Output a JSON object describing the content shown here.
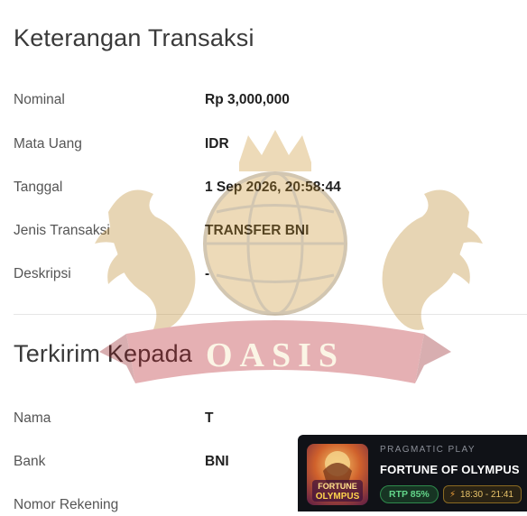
{
  "transaction": {
    "title": "Keterangan Transaksi",
    "rows": [
      {
        "label": "Nominal",
        "value": "Rp 3,000,000"
      },
      {
        "label": "Mata Uang",
        "value": "IDR"
      },
      {
        "label": "Tanggal",
        "value": "1 Sep 2026, 20:58:44"
      },
      {
        "label": "Jenis Transaksi",
        "value": "TRANSFER BNI"
      },
      {
        "label": "Deskripsi",
        "value": "-"
      }
    ]
  },
  "recipient": {
    "title": "Terkirim Kepada",
    "rows": [
      {
        "label": "Nama",
        "value": "T"
      },
      {
        "label": "Bank",
        "value": "BNI"
      },
      {
        "label": "Nomor Rekening",
        "value": ""
      }
    ]
  },
  "watermark": {
    "text": "OASIS",
    "colors": {
      "gold": "#c9922a",
      "ribbon": "#b3121b"
    }
  },
  "promo": {
    "provider": "PRAGMATIC PLAY",
    "game": "FORTUNE OF OLYMPUS",
    "thumb_text_top": "FORTUNE",
    "thumb_text_bottom": "OLYMPUS",
    "rtp": "RTP 85%",
    "time": "18:30 - 21:41",
    "colors": {
      "bg": "#101217",
      "rtp": "#63d68a",
      "time": "#e9c46a"
    }
  }
}
